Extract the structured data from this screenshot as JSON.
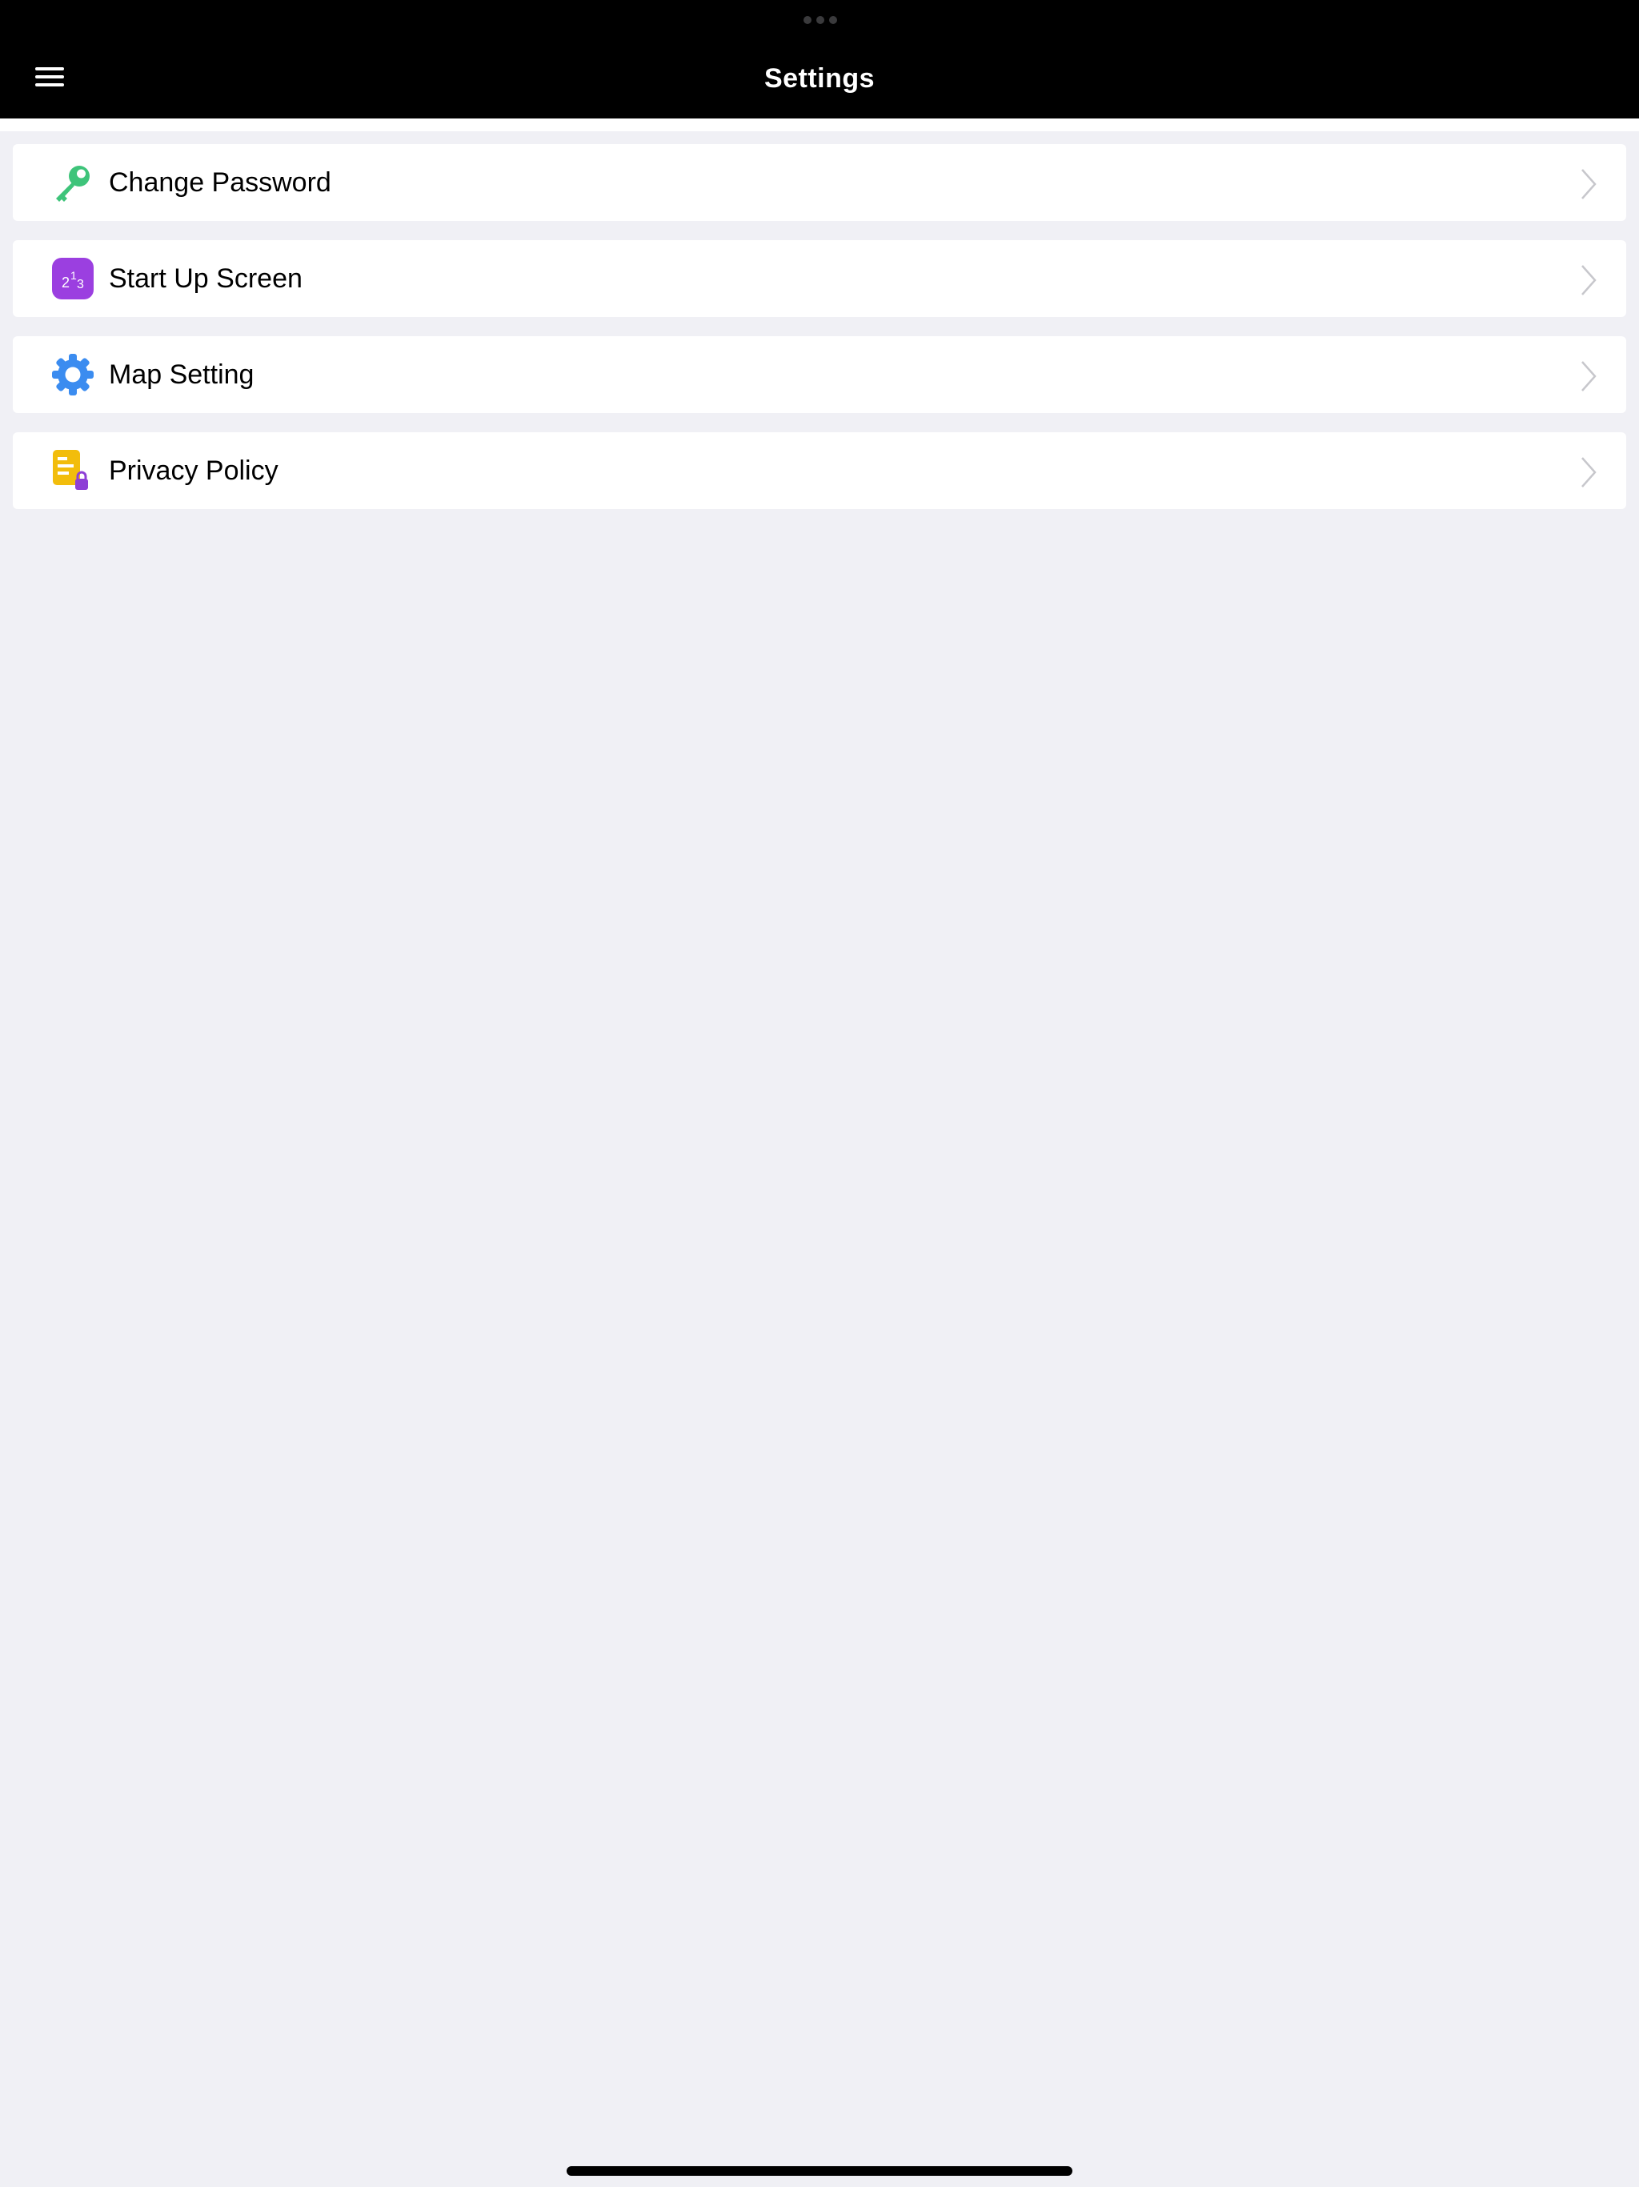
{
  "nav": {
    "title": "Settings",
    "menu_icon": "hamburger-menu-icon"
  },
  "settings": [
    {
      "label": "Change Password",
      "icon": "key-icon",
      "icon_color": "#3ec47a"
    },
    {
      "label": "Start Up Screen",
      "icon": "startup-number-icon",
      "icon_color": "#9b3fe0",
      "icon_text": "2",
      "icon_sup": "1",
      "icon_sub": "3"
    },
    {
      "label": "Map Setting",
      "icon": "gear-icon",
      "icon_color": "#3b8cf0"
    },
    {
      "label": "Privacy Policy",
      "icon": "document-lock-icon",
      "icon_color": "#f2bd0c"
    }
  ],
  "colors": {
    "nav_background": "#000000",
    "page_background": "#f0f0f5",
    "row_background": "#ffffff",
    "chevron": "#c7c7cc"
  }
}
